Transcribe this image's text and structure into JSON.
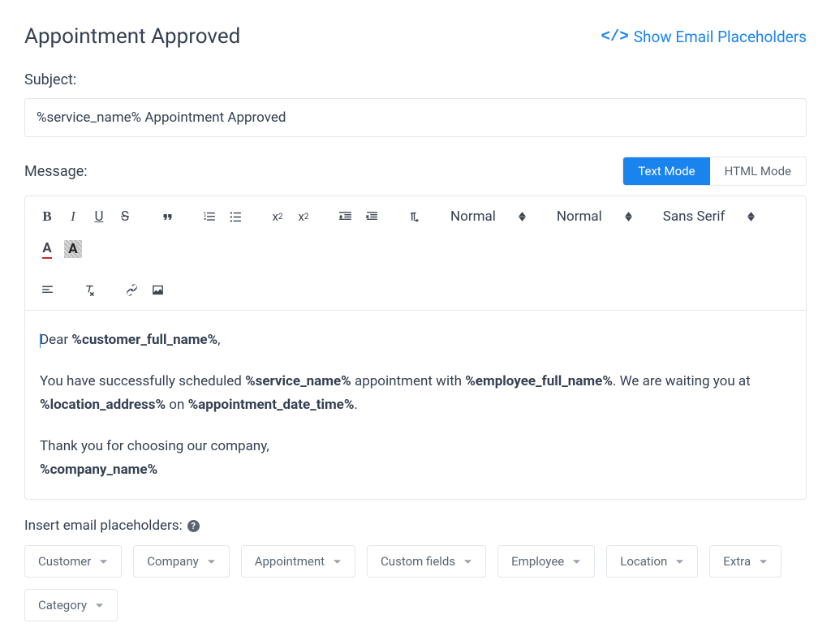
{
  "header": {
    "title": "Appointment Approved",
    "show_placeholders_link": "Show Email Placeholders",
    "show_placeholders_icon": "</>"
  },
  "subject": {
    "label": "Subject:",
    "value": "%service_name% Appointment Approved"
  },
  "message": {
    "label": "Message:",
    "text_mode": "Text Mode",
    "html_mode": "HTML Mode",
    "active_mode": "text"
  },
  "toolbar": {
    "select_format": "Normal",
    "select_size": "Normal",
    "select_font": "Sans Serif"
  },
  "content": {
    "greeting_pre": "Dear ",
    "greeting_ph": "%customer_full_name%",
    "greeting_post": ",",
    "body_1": "You have successfully scheduled ",
    "ph_service": "%service_name%",
    "body_2": " appointment with ",
    "ph_employee": "%employee_full_name%",
    "body_3": ". We are waiting you at ",
    "ph_location": "%location_address%",
    "body_4": " on ",
    "ph_datetime": "%appointment_date_time%",
    "body_5": ".",
    "thanks": "Thank you for choosing our company,",
    "ph_company": "%company_name%"
  },
  "insert": {
    "label": "Insert email placeholders:"
  },
  "dropdowns": [
    "Customer",
    "Company",
    "Appointment",
    "Custom fields",
    "Employee",
    "Location",
    "Extra",
    "Category"
  ]
}
